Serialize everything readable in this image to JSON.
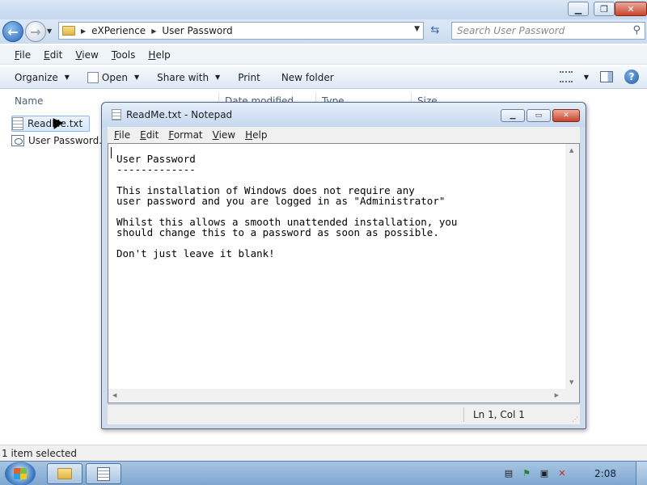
{
  "explorer": {
    "address": {
      "crumbs": [
        "eXPerience",
        "User Password"
      ]
    },
    "search_placeholder": "Search User Password",
    "menu": [
      "File",
      "Edit",
      "View",
      "Tools",
      "Help"
    ],
    "commands": {
      "organize": "Organize",
      "open": "Open",
      "share_with": "Share with",
      "print": "Print",
      "new_folder": "New folder"
    },
    "columns": [
      "Name",
      "Date modified",
      "Type",
      "Size"
    ],
    "files": [
      {
        "name": "ReadMe.txt",
        "icon": "text-file-icon",
        "selected": true
      },
      {
        "name": "User Password.b",
        "icon": "batch-file-icon",
        "selected": false
      }
    ],
    "status": "1 item selected"
  },
  "notepad": {
    "title": "ReadMe.txt - Notepad",
    "menu": [
      "File",
      "Edit",
      "Format",
      "View",
      "Help"
    ],
    "content": "User Password\n-------------\n\nThis installation of Windows does not require any\nuser password and you are logged in as \"Administrator\"\n\nWhilst this allows a smooth unattended installation, you\nshould change this to a password as soon as possible.\n\nDon't just leave it blank!",
    "status_position": "Ln 1, Col 1"
  },
  "taskbar": {
    "clock": "2:08",
    "tray_icons": [
      "notepad-tray-icon",
      "action-center-icon",
      "network-icon",
      "volume-muted-icon"
    ]
  },
  "colors": {
    "accent": "#2a67b8",
    "selection": "#d6e8fb",
    "close_button": "#c8442a"
  }
}
